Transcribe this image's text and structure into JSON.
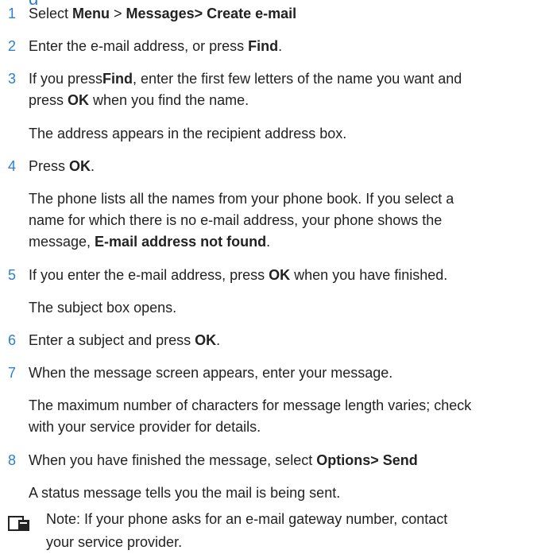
{
  "heading_partial": "g",
  "steps": [
    {
      "num": "1",
      "a": "Select ",
      "b1": "Menu",
      "c": " > ",
      "b2": "Messages> Create e-mail"
    },
    {
      "num": "2",
      "a": "Enter the e-mail address, or press ",
      "b1": "Find",
      "c": "."
    },
    {
      "num": "3",
      "a": "If you press",
      "b1": "Find",
      "c": ", enter the first few letters of the name you want and",
      "line2a": "press ",
      "line2b": "OK",
      "line2c": " when you find the name."
    },
    {
      "num": "4",
      "a": "Press ",
      "b1": "OK",
      "c": "."
    },
    {
      "num": "5",
      "a": "If you enter the e-mail address, press ",
      "b1": "OK",
      "c": " when you have finished."
    },
    {
      "num": "6",
      "a": "Enter a subject and press ",
      "b1": "OK",
      "c": "."
    },
    {
      "num": "7",
      "a": "When the message screen appears, enter your message."
    },
    {
      "num": "8",
      "a": "When you have finished the message, select ",
      "b1": "Options> Send"
    }
  ],
  "paras": {
    "p3": "The address appears in the recipient address box.",
    "p4a": "The phone lists all the names from your phone book. If you select a",
    "p4b": "name for which there is no e-mail address, your phone shows the",
    "p4c": "message, ",
    "p4bold": "E-mail address not found",
    "p4end": ".",
    "p5": "The subject box opens.",
    "p7a": "The maximum number of characters for message length varies; check",
    "p7b": "with your service provider for details.",
    "p8": "A status message tells you the mail is being sent."
  },
  "note": {
    "icon": "note-icon",
    "line1": "Note: If your phone asks for an e-mail gateway number, contact",
    "line2": "your service provider."
  },
  "colors": {
    "accent": "#2b7fd4",
    "text": "#222222"
  }
}
